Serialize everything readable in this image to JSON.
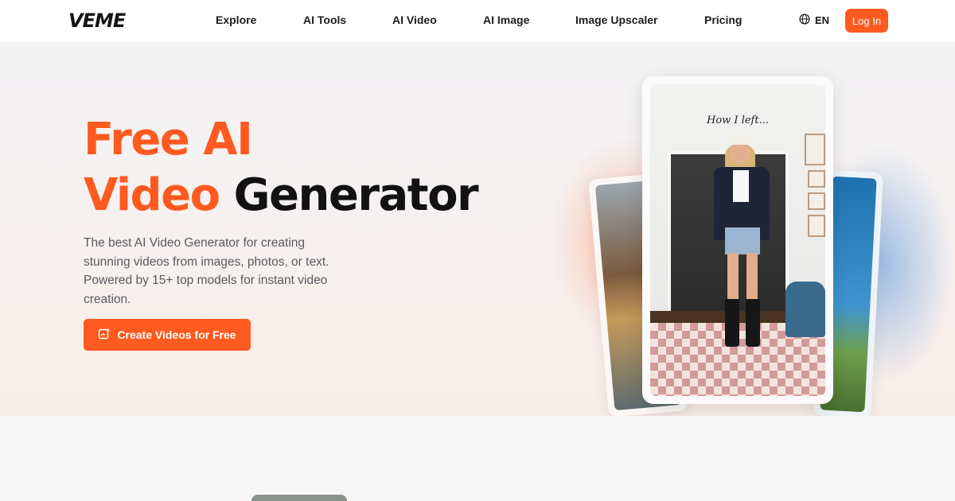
{
  "brand": {
    "logo_text": "VEME"
  },
  "nav": {
    "links": [
      "Explore",
      "AI Tools",
      "AI Video",
      "AI Image",
      "Image Upscaler",
      "Pricing"
    ],
    "language": "EN",
    "login_label": "Log In"
  },
  "hero": {
    "title_line1": "Free AI",
    "title_line2_accent": "Video",
    "title_line2_rest": "Generator",
    "description": "The best AI Video Generator for creating stunning videos from images, photos, or text. Powered by 15+ top models for instant video creation.",
    "cta_label": "Create Videos for Free",
    "showcase_caption": "How I left..."
  },
  "colors": {
    "accent": "#ff5a1f",
    "heading_dark": "#121212",
    "body_text": "#5a5a5f",
    "page_bg": "#f7f7f8"
  },
  "icons": {
    "language": "globe-icon",
    "cta": "image-sparkle-icon"
  }
}
